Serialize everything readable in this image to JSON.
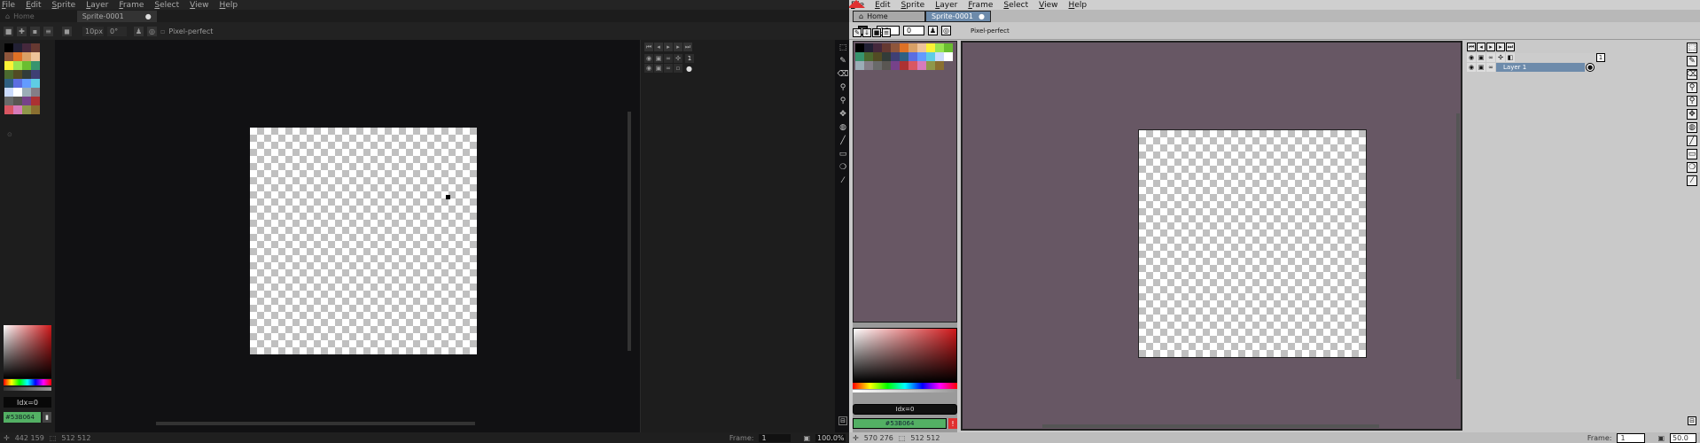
{
  "menu": [
    "File",
    "Edit",
    "Sprite",
    "Layer",
    "Frame",
    "Select",
    "View",
    "Help"
  ],
  "left": {
    "tabs": {
      "home": "Home",
      "sprite": "Sprite-0001"
    },
    "toolbar": {
      "brush_size": "10px",
      "angle": "0°",
      "pixel_perfect": "Pixel-perfect"
    },
    "color_index": "Idx=0",
    "color_hex": "#53B064",
    "status": {
      "coords": "442 159",
      "size": "512 512",
      "frame_label": "Frame:",
      "frame_value": "1",
      "zoom": "100.0%"
    },
    "palette": [
      "#000000",
      "#222034",
      "#45283c",
      "#663931",
      "#8f563b",
      "#df7126",
      "#d9a066",
      "#eec39a",
      "#fbf236",
      "#99e550",
      "#6abe30",
      "#37946e",
      "#4b692f",
      "#524b24",
      "#323c39",
      "#3f3f74",
      "#306082",
      "#5b6ee1",
      "#639bff",
      "#5fcde4",
      "#cbdbfc",
      "#ffffff",
      "#9badb7",
      "#847e87",
      "#696a6a",
      "#595652",
      "#76428a",
      "#ac3232",
      "#d95763",
      "#d77bba",
      "#8f974a",
      "#8a6f30"
    ]
  },
  "right": {
    "tabs": {
      "home": "Home",
      "sprite": "Sprite-0001"
    },
    "toolbar": {
      "brush_size": "10",
      "angle": "0",
      "pixel_perfect": "Pixel-perfect"
    },
    "color_index": "Idx=0",
    "color_hex": "#53B064",
    "layer_name": "Layer 1",
    "frame_number": "1",
    "status": {
      "coords": "570 276",
      "size": "512 512",
      "frame_label": "Frame:",
      "frame_value": "1",
      "zoom": "50.0"
    },
    "palette": [
      "#000000",
      "#222034",
      "#45283c",
      "#663931",
      "#8f563b",
      "#df7126",
      "#d9a066",
      "#eec39a",
      "#fbf236",
      "#99e550",
      "#6abe30",
      "#37946e",
      "#4b692f",
      "#524b24",
      "#323c39",
      "#3f3f74",
      "#306082",
      "#5b6ee1",
      "#639bff",
      "#5fcde4",
      "#cbdbfc",
      "#ffffff",
      "#9badb7",
      "#847e87",
      "#696a6a",
      "#595652",
      "#76428a",
      "#ac3232",
      "#d95763",
      "#d77bba",
      "#8f974a",
      "#8a6f30"
    ]
  },
  "colors": {
    "canvas_bg_right": "#675764",
    "accent_green": "#53b064",
    "logo_red": "#e03030"
  }
}
